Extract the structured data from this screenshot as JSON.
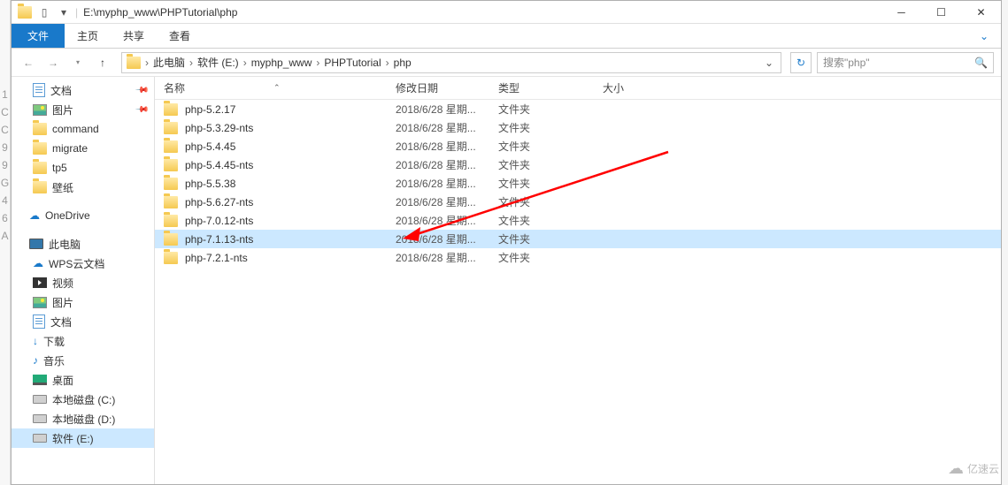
{
  "title_path": "E:\\myphp_www\\PHPTutorial\\php",
  "ribbon": {
    "file": "文件",
    "tabs": [
      "主页",
      "共享",
      "查看"
    ]
  },
  "breadcrumbs": [
    "此电脑",
    "软件 (E:)",
    "myphp_www",
    "PHPTutorial",
    "php"
  ],
  "search_placeholder": "搜索\"php\"",
  "columns": {
    "name": "名称",
    "date": "修改日期",
    "type": "类型",
    "size": "大小"
  },
  "sidebar": {
    "quick": [
      {
        "label": "文档",
        "icon": "doc",
        "pinned": true
      },
      {
        "label": "图片",
        "icon": "pic",
        "pinned": true
      },
      {
        "label": "command",
        "icon": "folder"
      },
      {
        "label": "migrate",
        "icon": "folder"
      },
      {
        "label": "tp5",
        "icon": "folder"
      },
      {
        "label": "壁纸",
        "icon": "folder"
      }
    ],
    "onedrive": "OneDrive",
    "thispc": "此电脑",
    "pc_items": [
      {
        "label": "WPS云文档",
        "icon": "cloud"
      },
      {
        "label": "视频",
        "icon": "video"
      },
      {
        "label": "图片",
        "icon": "pic"
      },
      {
        "label": "文档",
        "icon": "doc"
      },
      {
        "label": "下载",
        "icon": "dl"
      },
      {
        "label": "音乐",
        "icon": "music"
      },
      {
        "label": "桌面",
        "icon": "desk"
      },
      {
        "label": "本地磁盘 (C:)",
        "icon": "drive"
      },
      {
        "label": "本地磁盘 (D:)",
        "icon": "drive"
      },
      {
        "label": "软件 (E:)",
        "icon": "drive",
        "selected": true
      }
    ]
  },
  "files": [
    {
      "name": "php-5.2.17",
      "date": "2018/6/28 星期...",
      "type": "文件夹"
    },
    {
      "name": "php-5.3.29-nts",
      "date": "2018/6/28 星期...",
      "type": "文件夹"
    },
    {
      "name": "php-5.4.45",
      "date": "2018/6/28 星期...",
      "type": "文件夹"
    },
    {
      "name": "php-5.4.45-nts",
      "date": "2018/6/28 星期...",
      "type": "文件夹"
    },
    {
      "name": "php-5.5.38",
      "date": "2018/6/28 星期...",
      "type": "文件夹"
    },
    {
      "name": "php-5.6.27-nts",
      "date": "2018/6/28 星期...",
      "type": "文件夹"
    },
    {
      "name": "php-7.0.12-nts",
      "date": "2018/6/28 星期...",
      "type": "文件夹"
    },
    {
      "name": "php-7.1.13-nts",
      "date": "2018/6/28 星期...",
      "type": "文件夹",
      "selected": true
    },
    {
      "name": "php-7.2.1-nts",
      "date": "2018/6/28 星期...",
      "type": "文件夹"
    }
  ],
  "watermark": "亿速云",
  "gutter": [
    "1",
    "C",
    "C",
    "9",
    "9",
    "G",
    "4",
    "6",
    "A"
  ]
}
